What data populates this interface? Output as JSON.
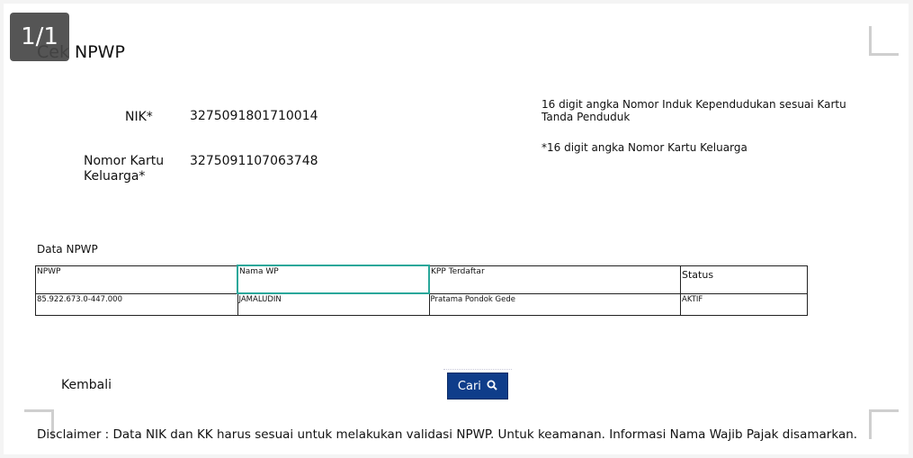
{
  "viewer": {
    "page_indicator": "1/1"
  },
  "form": {
    "title": "Cek NPWP",
    "nik": {
      "label": "NIK*",
      "value": "3275091801710014",
      "hint": "16 digit angka Nomor Induk Kependudukan sesuai Kartu Tanda Penduduk"
    },
    "kk": {
      "label_line1": "Nomor Kartu",
      "label_line2": "Keluarga*",
      "value": "3275091107063748",
      "hint": "*16 digit angka Nomor Kartu Keluarga"
    }
  },
  "result": {
    "section_label": "Data NPWP",
    "columns": [
      "NPWP",
      "Nama WP",
      "KPP Terdaftar",
      "Status"
    ],
    "rows": [
      [
        "85.922.673.0-447.000",
        "JAMALUDIN",
        "Pratama Pondok Gede",
        "AKTIF"
      ]
    ]
  },
  "actions": {
    "back_label": "Kembali",
    "search_label": "Cari"
  },
  "disclaimer": "Disclaimer : Data NIK dan KK harus sesuai untuk melakukan validasi NPWP. Untuk keamanan. Informasi Nama Wajib Pajak disamarkan.",
  "colors": {
    "button_bg": "#0f3d8a",
    "selected_cell_border": "#2aa79a"
  }
}
